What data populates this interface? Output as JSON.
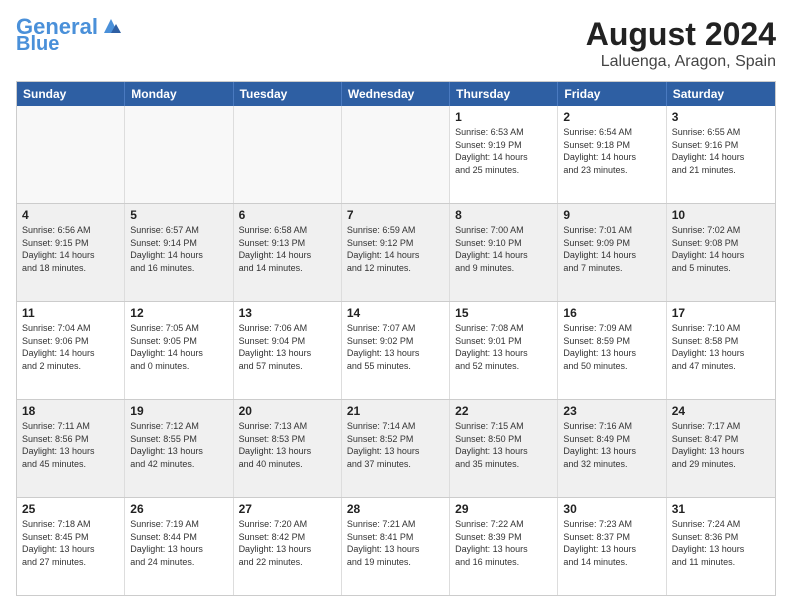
{
  "header": {
    "logo_general": "General",
    "logo_blue": "Blue",
    "title": "August 2024",
    "subtitle": "Laluenga, Aragon, Spain"
  },
  "days_of_week": [
    "Sunday",
    "Monday",
    "Tuesday",
    "Wednesday",
    "Thursday",
    "Friday",
    "Saturday"
  ],
  "weeks": [
    [
      {
        "day": "",
        "info": "",
        "empty": true
      },
      {
        "day": "",
        "info": "",
        "empty": true
      },
      {
        "day": "",
        "info": "",
        "empty": true
      },
      {
        "day": "",
        "info": "",
        "empty": true
      },
      {
        "day": "1",
        "info": "Sunrise: 6:53 AM\nSunset: 9:19 PM\nDaylight: 14 hours\nand 25 minutes.",
        "empty": false
      },
      {
        "day": "2",
        "info": "Sunrise: 6:54 AM\nSunset: 9:18 PM\nDaylight: 14 hours\nand 23 minutes.",
        "empty": false
      },
      {
        "day": "3",
        "info": "Sunrise: 6:55 AM\nSunset: 9:16 PM\nDaylight: 14 hours\nand 21 minutes.",
        "empty": false
      }
    ],
    [
      {
        "day": "4",
        "info": "Sunrise: 6:56 AM\nSunset: 9:15 PM\nDaylight: 14 hours\nand 18 minutes.",
        "empty": false
      },
      {
        "day": "5",
        "info": "Sunrise: 6:57 AM\nSunset: 9:14 PM\nDaylight: 14 hours\nand 16 minutes.",
        "empty": false
      },
      {
        "day": "6",
        "info": "Sunrise: 6:58 AM\nSunset: 9:13 PM\nDaylight: 14 hours\nand 14 minutes.",
        "empty": false
      },
      {
        "day": "7",
        "info": "Sunrise: 6:59 AM\nSunset: 9:12 PM\nDaylight: 14 hours\nand 12 minutes.",
        "empty": false
      },
      {
        "day": "8",
        "info": "Sunrise: 7:00 AM\nSunset: 9:10 PM\nDaylight: 14 hours\nand 9 minutes.",
        "empty": false
      },
      {
        "day": "9",
        "info": "Sunrise: 7:01 AM\nSunset: 9:09 PM\nDaylight: 14 hours\nand 7 minutes.",
        "empty": false
      },
      {
        "day": "10",
        "info": "Sunrise: 7:02 AM\nSunset: 9:08 PM\nDaylight: 14 hours\nand 5 minutes.",
        "empty": false
      }
    ],
    [
      {
        "day": "11",
        "info": "Sunrise: 7:04 AM\nSunset: 9:06 PM\nDaylight: 14 hours\nand 2 minutes.",
        "empty": false
      },
      {
        "day": "12",
        "info": "Sunrise: 7:05 AM\nSunset: 9:05 PM\nDaylight: 14 hours\nand 0 minutes.",
        "empty": false
      },
      {
        "day": "13",
        "info": "Sunrise: 7:06 AM\nSunset: 9:04 PM\nDaylight: 13 hours\nand 57 minutes.",
        "empty": false
      },
      {
        "day": "14",
        "info": "Sunrise: 7:07 AM\nSunset: 9:02 PM\nDaylight: 13 hours\nand 55 minutes.",
        "empty": false
      },
      {
        "day": "15",
        "info": "Sunrise: 7:08 AM\nSunset: 9:01 PM\nDaylight: 13 hours\nand 52 minutes.",
        "empty": false
      },
      {
        "day": "16",
        "info": "Sunrise: 7:09 AM\nSunset: 8:59 PM\nDaylight: 13 hours\nand 50 minutes.",
        "empty": false
      },
      {
        "day": "17",
        "info": "Sunrise: 7:10 AM\nSunset: 8:58 PM\nDaylight: 13 hours\nand 47 minutes.",
        "empty": false
      }
    ],
    [
      {
        "day": "18",
        "info": "Sunrise: 7:11 AM\nSunset: 8:56 PM\nDaylight: 13 hours\nand 45 minutes.",
        "empty": false
      },
      {
        "day": "19",
        "info": "Sunrise: 7:12 AM\nSunset: 8:55 PM\nDaylight: 13 hours\nand 42 minutes.",
        "empty": false
      },
      {
        "day": "20",
        "info": "Sunrise: 7:13 AM\nSunset: 8:53 PM\nDaylight: 13 hours\nand 40 minutes.",
        "empty": false
      },
      {
        "day": "21",
        "info": "Sunrise: 7:14 AM\nSunset: 8:52 PM\nDaylight: 13 hours\nand 37 minutes.",
        "empty": false
      },
      {
        "day": "22",
        "info": "Sunrise: 7:15 AM\nSunset: 8:50 PM\nDaylight: 13 hours\nand 35 minutes.",
        "empty": false
      },
      {
        "day": "23",
        "info": "Sunrise: 7:16 AM\nSunset: 8:49 PM\nDaylight: 13 hours\nand 32 minutes.",
        "empty": false
      },
      {
        "day": "24",
        "info": "Sunrise: 7:17 AM\nSunset: 8:47 PM\nDaylight: 13 hours\nand 29 minutes.",
        "empty": false
      }
    ],
    [
      {
        "day": "25",
        "info": "Sunrise: 7:18 AM\nSunset: 8:45 PM\nDaylight: 13 hours\nand 27 minutes.",
        "empty": false
      },
      {
        "day": "26",
        "info": "Sunrise: 7:19 AM\nSunset: 8:44 PM\nDaylight: 13 hours\nand 24 minutes.",
        "empty": false
      },
      {
        "day": "27",
        "info": "Sunrise: 7:20 AM\nSunset: 8:42 PM\nDaylight: 13 hours\nand 22 minutes.",
        "empty": false
      },
      {
        "day": "28",
        "info": "Sunrise: 7:21 AM\nSunset: 8:41 PM\nDaylight: 13 hours\nand 19 minutes.",
        "empty": false
      },
      {
        "day": "29",
        "info": "Sunrise: 7:22 AM\nSunset: 8:39 PM\nDaylight: 13 hours\nand 16 minutes.",
        "empty": false
      },
      {
        "day": "30",
        "info": "Sunrise: 7:23 AM\nSunset: 8:37 PM\nDaylight: 13 hours\nand 14 minutes.",
        "empty": false
      },
      {
        "day": "31",
        "info": "Sunrise: 7:24 AM\nSunset: 8:36 PM\nDaylight: 13 hours\nand 11 minutes.",
        "empty": false
      }
    ]
  ]
}
